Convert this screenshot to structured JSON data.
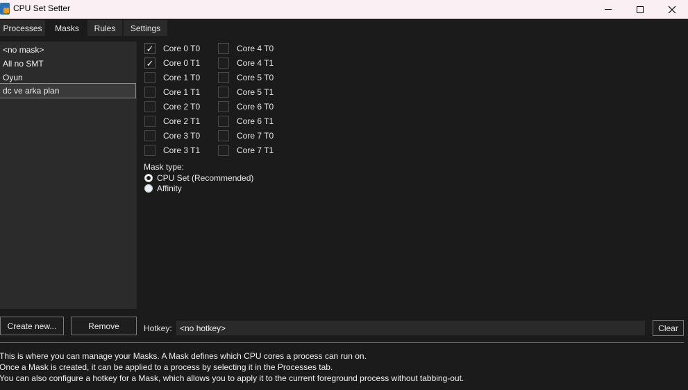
{
  "window": {
    "title": "CPU Set Setter",
    "controls": {
      "minimize": "minimize-icon",
      "maximize": "maximize-icon",
      "close": "close-icon"
    }
  },
  "tabs": [
    {
      "label": "Processes"
    },
    {
      "label": "Masks",
      "selected": true
    },
    {
      "label": "Rules"
    },
    {
      "label": "Settings"
    }
  ],
  "masks": [
    {
      "label": "<no mask>"
    },
    {
      "label": "All no SMT"
    },
    {
      "label": "Oyun"
    },
    {
      "label": "dc ve arka plan",
      "selected": true
    }
  ],
  "cores": [
    {
      "label": "Core 0 T0",
      "checked": true
    },
    {
      "label": "Core 0 T1",
      "checked": true
    },
    {
      "label": "Core 1 T0",
      "checked": false
    },
    {
      "label": "Core 1 T1",
      "checked": false
    },
    {
      "label": "Core 2 T0",
      "checked": false
    },
    {
      "label": "Core 2 T1",
      "checked": false
    },
    {
      "label": "Core 3 T0",
      "checked": false
    },
    {
      "label": "Core 3 T1",
      "checked": false
    },
    {
      "label": "Core 4 T0",
      "checked": false
    },
    {
      "label": "Core 4 T1",
      "checked": false
    },
    {
      "label": "Core 5 T0",
      "checked": false
    },
    {
      "label": "Core 5 T1",
      "checked": false
    },
    {
      "label": "Core 6 T0",
      "checked": false
    },
    {
      "label": "Core 6 T1",
      "checked": false
    },
    {
      "label": "Core 7 T0",
      "checked": false
    },
    {
      "label": "Core 7 T1",
      "checked": false
    }
  ],
  "mask_type": {
    "label": "Mask type:",
    "options": [
      {
        "label": "CPU Set (Recommended)",
        "selected": true
      },
      {
        "label": "Affinity",
        "selected": false
      }
    ]
  },
  "buttons": {
    "create": "Create new...",
    "remove": "Remove",
    "clear": "Clear"
  },
  "hotkey": {
    "label": "Hotkey:",
    "value": "<no hotkey>"
  },
  "help": [
    "This is where you can manage your Masks. A Mask defines which CPU cores a process can run on.",
    "Once a Mask is created, it can be applied to a process by selecting it in the Processes tab.",
    "You can also configure a hotkey for a Mask, which allows you to apply it to the current foreground process without tabbing-out."
  ]
}
